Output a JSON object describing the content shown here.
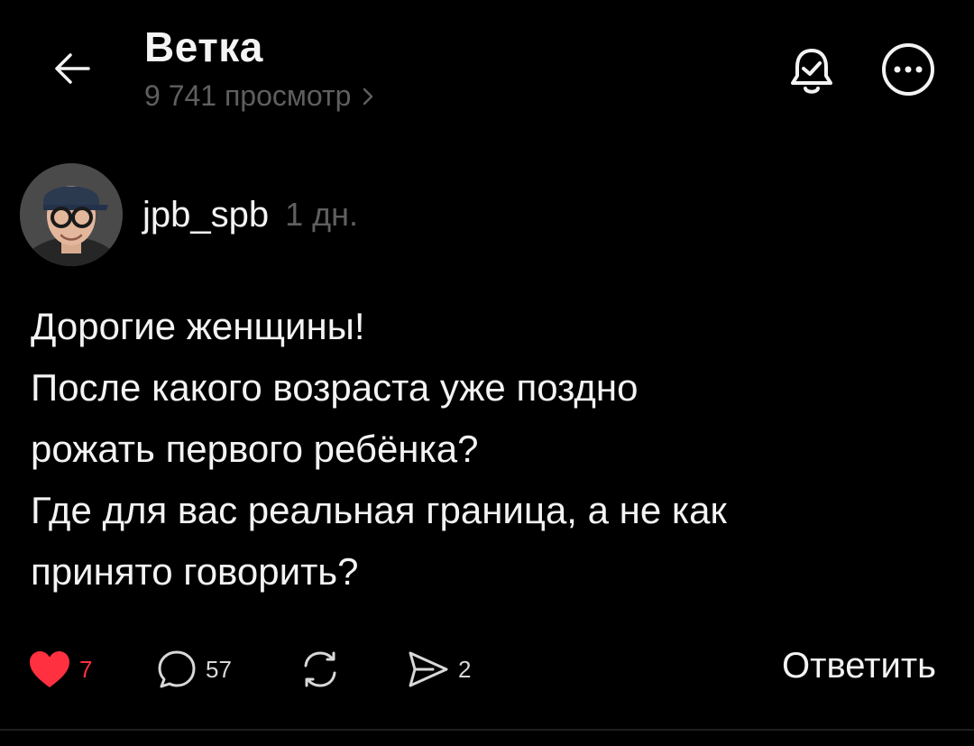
{
  "header": {
    "title": "Ветка",
    "views": "9 741 просмотр",
    "back_icon": "arrow-left-icon",
    "notif_icon": "bell-check-icon",
    "more_icon": "more-horizontal-icon"
  },
  "post": {
    "author": {
      "username": "jpb_spb",
      "time": "1 дн.",
      "avatar_icon": "avatar-photo"
    },
    "lines": [
      "Дорогие женщины!",
      "После какого возраста уже поздно",
      "рожать первого ребёнка?",
      "Где для вас реальная граница, а не как",
      "принято говорить?"
    ],
    "actions": {
      "likes": "7",
      "comments": "57",
      "shares": "2",
      "reply_label": "Ответить"
    }
  },
  "colors": {
    "background": "#000000",
    "text": "#f3f3f3",
    "muted": "#5f5f5f",
    "like": "#ff3040"
  }
}
